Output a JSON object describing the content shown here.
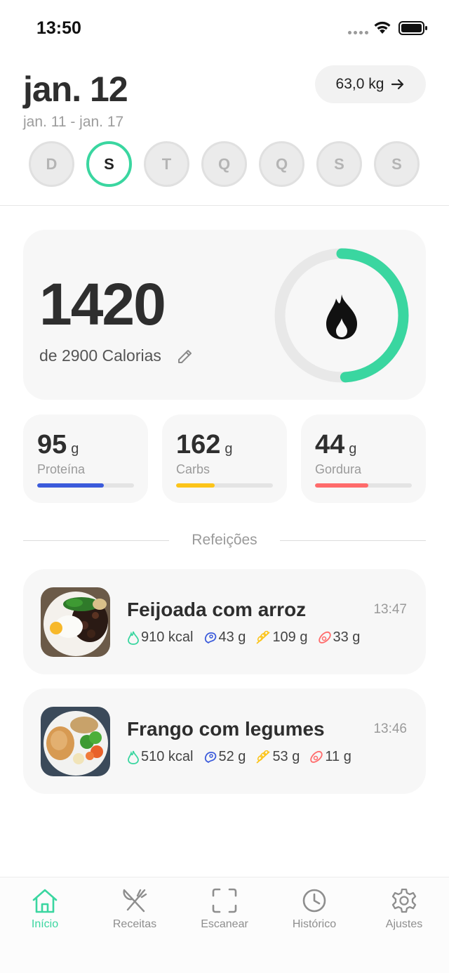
{
  "status_bar": {
    "time": "13:50"
  },
  "header": {
    "date": "jan. 12",
    "range": "jan. 11 - jan. 17",
    "weight": "63,0 kg"
  },
  "week": {
    "days": [
      "D",
      "S",
      "T",
      "Q",
      "Q",
      "S",
      "S"
    ],
    "active_index": 1
  },
  "calories": {
    "consumed": "1420",
    "goal_text": "de 2900 Calorias",
    "progress": 0.49
  },
  "macros": [
    {
      "value": "95",
      "unit": "g",
      "label": "Proteína",
      "progress": 0.69,
      "color": "#3b5bdb"
    },
    {
      "value": "162",
      "unit": "g",
      "label": "Carbs",
      "progress": 0.4,
      "color": "#fcc419"
    },
    {
      "value": "44",
      "unit": "g",
      "label": "Gordura",
      "progress": 0.55,
      "color": "#ff6b6b"
    }
  ],
  "meals_title": "Refeições",
  "meals": [
    {
      "name": "Feijoada com arroz",
      "time": "13:47",
      "kcal": "910 kcal",
      "protein": "43 g",
      "carbs": "109 g",
      "fat": "33 g",
      "image": "feijoada-photo"
    },
    {
      "name": "Frango com legumes",
      "time": "13:46",
      "kcal": "510 kcal",
      "protein": "52 g",
      "carbs": "53 g",
      "fat": "11 g",
      "image": "chicken-vegetables-photo"
    }
  ],
  "tabs": [
    {
      "label": "Início",
      "icon": "home-icon",
      "active": true
    },
    {
      "label": "Receitas",
      "icon": "utensils-icon",
      "active": false
    },
    {
      "label": "Escanear",
      "icon": "scan-icon",
      "active": false
    },
    {
      "label": "Histórico",
      "icon": "clock-icon",
      "active": false
    },
    {
      "label": "Ajustes",
      "icon": "gear-icon",
      "active": false
    }
  ],
  "colors": {
    "accent": "#3ad6a0",
    "protein": "#3b5bdb",
    "carbs": "#fcc419",
    "fat": "#ff6b6b"
  }
}
